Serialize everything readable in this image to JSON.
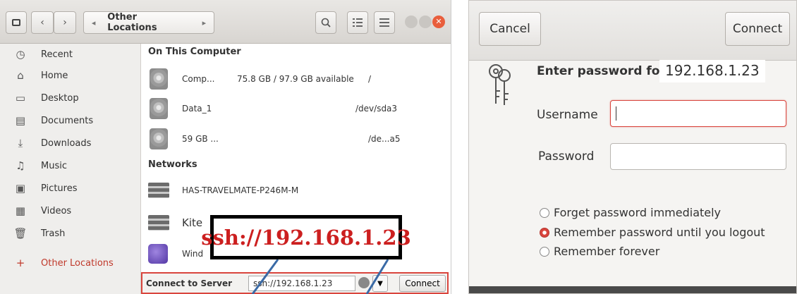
{
  "files": {
    "path_label": "Other Locations",
    "nav": {
      "back": "‹",
      "forward": "›",
      "prev": "◂",
      "next": "▸"
    },
    "toolbar_icons": [
      "search-icon",
      "list-view-icon",
      "menu-icon"
    ],
    "sidebar": {
      "items": [
        {
          "label": "Recent",
          "icon": "◷"
        },
        {
          "label": "Home",
          "icon": "⌂"
        },
        {
          "label": "Desktop",
          "icon": "▭"
        },
        {
          "label": "Documents",
          "icon": "▤"
        },
        {
          "label": "Downloads",
          "icon": "⤓"
        },
        {
          "label": "Music",
          "icon": "♫"
        },
        {
          "label": "Pictures",
          "icon": "▣"
        },
        {
          "label": "Videos",
          "icon": "▦"
        },
        {
          "label": "Trash",
          "icon": "🗑"
        },
        {
          "label": "Other Locations",
          "icon": "+"
        }
      ],
      "active_color": "#c0392b"
    },
    "sections": {
      "computer": "On This Computer",
      "networks": "Networks"
    },
    "computer_rows": [
      {
        "name": "Comp...",
        "size": "75.8 GB / 97.9 GB available",
        "mount": "/"
      },
      {
        "name": "Data_1",
        "size": "",
        "mount": "/dev/sda3"
      },
      {
        "name": "59 GB ...",
        "size": "",
        "mount": "/de...a5"
      }
    ],
    "network_rows": [
      {
        "name": "HAS-TRAVELMATE-P246M-M"
      },
      {
        "name": "Kite"
      },
      {
        "name": "Wind"
      }
    ],
    "connect_bar": {
      "label": "Connect to Server",
      "value": "ssh://192.168.1.23",
      "connect": "Connect"
    },
    "callout": "ssh://192.168.1.23",
    "accent": "#d9453d"
  },
  "dialog": {
    "cancel": "Cancel",
    "connect": "Connect",
    "prompt": "Enter password for",
    "host": "192.168.1.23",
    "username_label": "Username",
    "password_label": "Password",
    "username_value": "",
    "password_value": "",
    "options": [
      {
        "label": "Forget password immediately",
        "selected": false
      },
      {
        "label": "Remember password until you logout",
        "selected": true
      },
      {
        "label": "Remember forever",
        "selected": false
      }
    ]
  }
}
